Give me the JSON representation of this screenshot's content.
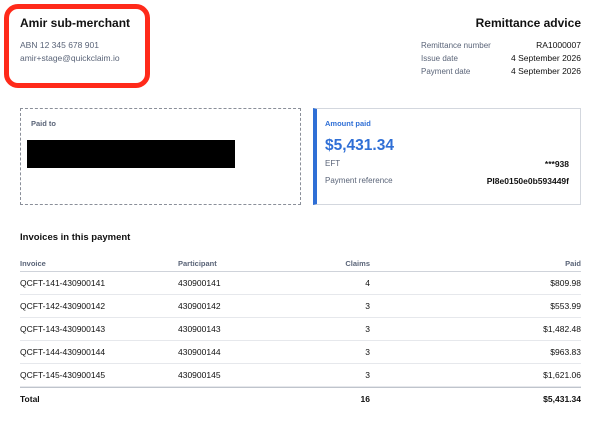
{
  "merchant": {
    "name": "Amir sub-merchant",
    "abn": "ABN 12 345 678 901",
    "email": "amir+stage@quickclaim.io"
  },
  "document": {
    "title": "Remittance advice",
    "meta": [
      {
        "label": "Remittance number",
        "value": "RA1000007"
      },
      {
        "label": "Issue date",
        "value": "4 September 2026"
      },
      {
        "label": "Payment date",
        "value": "4 September 2026"
      }
    ]
  },
  "paid_to": {
    "label": "Paid to"
  },
  "amount": {
    "label": "Amount paid",
    "value": "$5,431.34",
    "method_label": "EFT",
    "method_value": "***938",
    "reference_label": "Payment reference",
    "reference_value": "PI8e0150e0b593449f"
  },
  "invoices": {
    "title": "Invoices in this payment",
    "columns": {
      "invoice": "Invoice",
      "participant": "Participant",
      "claims": "Claims",
      "paid": "Paid"
    },
    "rows": [
      {
        "invoice": "QCFT-141-430900141",
        "participant": "430900141",
        "claims": "4",
        "paid": "$809.98"
      },
      {
        "invoice": "QCFT-142-430900142",
        "participant": "430900142",
        "claims": "3",
        "paid": "$553.99"
      },
      {
        "invoice": "QCFT-143-430900143",
        "participant": "430900143",
        "claims": "3",
        "paid": "$1,482.48"
      },
      {
        "invoice": "QCFT-144-430900144",
        "participant": "430900144",
        "claims": "3",
        "paid": "$963.83"
      },
      {
        "invoice": "QCFT-145-430900145",
        "participant": "430900145",
        "claims": "3",
        "paid": "$1,621.06"
      }
    ],
    "total": {
      "label": "Total",
      "claims": "16",
      "paid": "$5,431.34"
    }
  },
  "colors": {
    "accent": "#2f6fd6",
    "highlight": "#ff2a1a",
    "muted_text": "#5a6478"
  }
}
